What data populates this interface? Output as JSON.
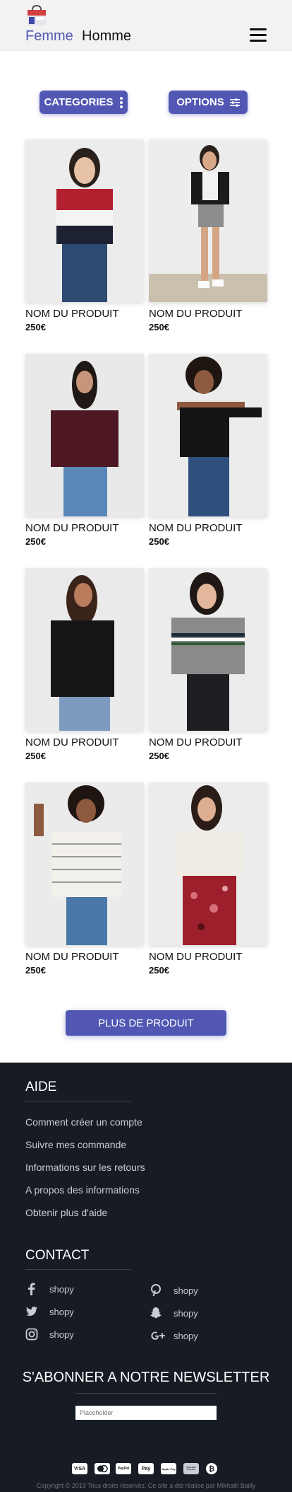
{
  "header": {
    "logo_icon": "shop-bag-logo-icon",
    "nav": [
      "Femme",
      "Homme"
    ],
    "menu_icon": "hamburger-icon",
    "accent": "#5157b3"
  },
  "filters": {
    "categories_label": "CATEGORIES",
    "categories_icon": "vertical-dots-icon",
    "options_label": "OPTIONS",
    "options_icon": "sliders-icon"
  },
  "products": [
    {
      "name": "NOM DU PRODUIT",
      "price": "250€"
    },
    {
      "name": "NOM DU PRODUIT",
      "price": "250€"
    },
    {
      "name": "NOM DU PRODUIT",
      "price": "250€"
    },
    {
      "name": "NOM DU PRODUIT",
      "price": "250€"
    },
    {
      "name": "NOM DU PRODUIT",
      "price": "250€"
    },
    {
      "name": "NOM DU PRODUIT",
      "price": "250€"
    },
    {
      "name": "NOM DU PRODUIT",
      "price": "250€"
    },
    {
      "name": "NOM DU PRODUIT",
      "price": "250€"
    }
  ],
  "more_button": "PLUS DE PRODUIT",
  "footer": {
    "help": {
      "title": "AIDE",
      "links": [
        "Comment créer un compte",
        "Suivre mes commande",
        "Informations sur les retours",
        "A propos des informations",
        "Obtenir plus d'aide"
      ]
    },
    "contact": {
      "title": "CONTACT",
      "items": [
        {
          "icon": "facebook-icon",
          "label": "shopy"
        },
        {
          "icon": "pinterest-icon",
          "label": "shopy"
        },
        {
          "icon": "twitter-icon",
          "label": "shopy"
        },
        {
          "icon": "snapchat-icon",
          "label": "shopy"
        },
        {
          "icon": "instagram-icon",
          "label": "shopy"
        },
        {
          "icon": "google-plus-icon",
          "label": "shopy"
        }
      ]
    },
    "newsletter": {
      "title": "S'ABONNER A NOTRE NEWSLETTER",
      "placeholder": "Placeholder"
    },
    "payments": [
      "VISA",
      "mastercard",
      "PayPal",
      "Pay",
      "Apple Pay",
      "American Express",
      "bitcoin"
    ],
    "copyright": "Copyright © 2019 Tous droits réservés. Ce site a été réalise par Mikhaël Bailly",
    "bg": "#171c24"
  }
}
